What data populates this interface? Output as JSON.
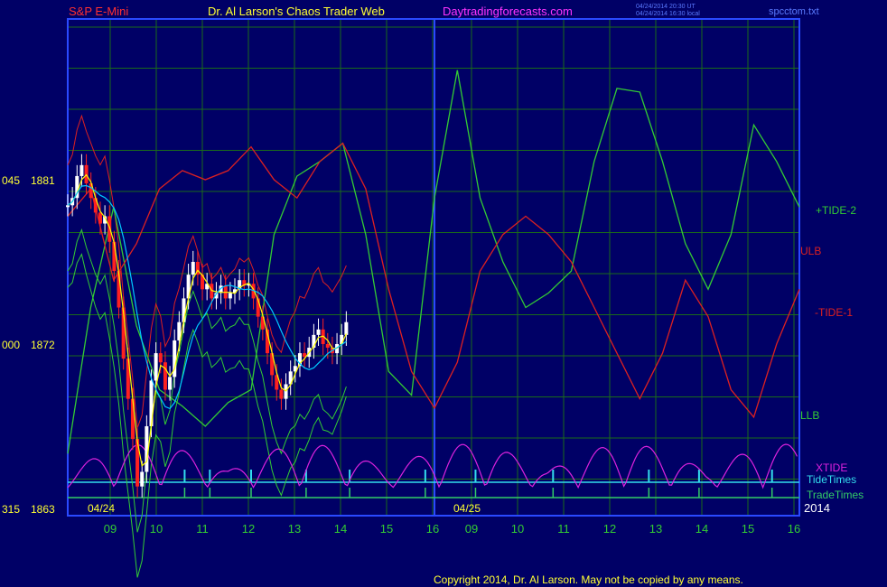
{
  "header": {
    "instrument": "S&P E-Mini",
    "site_title": "Dr. Al Larson's Chaos Trader Web",
    "site_url": "Daytradingforecasts.com",
    "stamp_line1": "04/24/2014 20:30 UT",
    "stamp_line2": "04/24/2014 16:30 local",
    "filename": "spcctom.txt"
  },
  "footer": {
    "copyright": "Copyright 2014, Dr. Al Larson. May not be copied by any means."
  },
  "colors": {
    "background": "#000066",
    "frame": "#2a4aff",
    "grid": "#1a6a1a",
    "price_up": "#ffffff",
    "price_down": "#ff2020",
    "ma_yellow": "#ffff00",
    "ma_cyan": "#00c8ff",
    "tide2": "#33cc33",
    "tide1": "#dd2020",
    "xtide": "#dd22dd",
    "tidetimes": "#33ddee",
    "tradetimes": "#33cc66"
  },
  "chart_data": {
    "type": "line",
    "title": "S&P E-Mini",
    "price_axis": {
      "ticks": [
        1881,
        1872,
        1863
      ],
      "alt_ticks": [
        "045",
        "000",
        "315"
      ],
      "ylim": [
        1863,
        1883
      ]
    },
    "x_hour_labels": [
      "09",
      "10",
      "11",
      "12",
      "13",
      "14",
      "15",
      "16",
      "09",
      "10",
      "11",
      "12",
      "13",
      "14",
      "15",
      "16"
    ],
    "date_labels": [
      "04/24",
      "04/25"
    ],
    "year_label": "2014",
    "xlim": [
      0,
      16
    ],
    "grid": true,
    "legend": {
      "placement": "right",
      "entries": [
        "+TIDE-2",
        "ULB",
        "-TIDE-1",
        "LLB",
        "XTIDE",
        "TideTimes",
        "TradeTimes"
      ]
    },
    "price": {
      "x": [
        0.0,
        0.1,
        0.2,
        0.3,
        0.4,
        0.5,
        0.6,
        0.7,
        0.8,
        0.9,
        1.0,
        1.1,
        1.2,
        1.3,
        1.4,
        1.5,
        1.6,
        1.7,
        1.8,
        1.9,
        2.0,
        2.1,
        2.2,
        2.3,
        2.4,
        2.5,
        2.6,
        2.7,
        2.8,
        2.9,
        3.0,
        3.1,
        3.2,
        3.3,
        3.4,
        3.5,
        3.6,
        3.7,
        3.8,
        3.9,
        4.0,
        4.1,
        4.2,
        4.3,
        4.4,
        4.5,
        4.6,
        4.7,
        4.8,
        4.9,
        5.0,
        5.1,
        5.2,
        5.3,
        5.4,
        5.5,
        5.6,
        5.7,
        5.8,
        5.9,
        6.0,
        6.1,
        6.2,
        6.3,
        6.4,
        6.5,
        6.6,
        6.7,
        6.8,
        6.9,
        7.0,
        7.1,
        7.2,
        7.3,
        7.4,
        7.5,
        7.6,
        7.7,
        7.8,
        7.9
      ],
      "y": [
        1879.6,
        1880.0,
        1881.2,
        1881.8,
        1880.8,
        1880.0,
        1879.2,
        1878.6,
        1879.0,
        1877.6,
        1876.0,
        1874.0,
        1871.2,
        1869.0,
        1866.8,
        1864.2,
        1865.0,
        1867.5,
        1870.0,
        1871.5,
        1871.0,
        1869.5,
        1870.2,
        1872.2,
        1873.2,
        1874.5,
        1875.8,
        1876.5,
        1875.8,
        1875.0,
        1875.3,
        1874.5,
        1874.8,
        1875.2,
        1874.5,
        1874.8,
        1875.0,
        1875.5,
        1875.2,
        1875.3,
        1874.5,
        1873.5,
        1872.8,
        1871.5,
        1870.3,
        1869.5,
        1869.0,
        1869.8,
        1870.5,
        1870.8,
        1871.5,
        1871.3,
        1871.8,
        1872.5,
        1872.8,
        1872.0,
        1871.8,
        1871.5,
        1872.0,
        1872.5,
        1873.2
      ],
      "note": "intraday close values read from the 04/24 session"
    },
    "series": [
      {
        "name": "+TIDE-2",
        "x": [
          0,
          0.5,
          1,
          1.5,
          2,
          2.5,
          3,
          3.5,
          4,
          4.5,
          5,
          5.5,
          6,
          6.5,
          7,
          7.5,
          8,
          8.5,
          9,
          9.5,
          10,
          10.5,
          11,
          11.5,
          12,
          12.5,
          13,
          13.5,
          14,
          14.5,
          15,
          15.5,
          16
        ],
        "y": [
          1866.0,
          1874.0,
          1879.5,
          1873.0,
          1869.5,
          1868.6,
          1867.5,
          1868.8,
          1869.5,
          1878.0,
          1881.2,
          1882.0,
          1883.0,
          1878.0,
          1870.5,
          1869.2,
          1880.0,
          1887.0,
          1880.0,
          1876.5,
          1874.0,
          1874.8,
          1876.0,
          1882.0,
          1886.0,
          1885.8,
          1882.0,
          1877.5,
          1875.0,
          1878.0,
          1884.0,
          1882.0,
          1879.5
        ]
      },
      {
        "name": "-TIDE-1",
        "x": [
          0,
          0.5,
          1,
          1.5,
          2,
          2.5,
          3,
          3.5,
          4,
          4.5,
          5,
          5.5,
          6,
          6.5,
          7,
          7.5,
          8,
          8.5,
          9,
          9.5,
          10,
          10.5,
          11,
          11.5,
          12,
          12.5,
          13,
          13.5,
          14,
          14.5,
          15,
          15.5,
          16
        ],
        "y": [
          1879.0,
          1880.5,
          1875.5,
          1877.5,
          1880.5,
          1881.5,
          1881.0,
          1881.5,
          1882.8,
          1881.0,
          1880.0,
          1882.0,
          1883.0,
          1880.5,
          1875.0,
          1870.5,
          1868.5,
          1871.0,
          1876.0,
          1878.0,
          1879.0,
          1878.0,
          1876.5,
          1874.0,
          1871.5,
          1869.0,
          1871.5,
          1875.5,
          1873.5,
          1869.5,
          1868.0,
          1872.0,
          1875.0
        ]
      }
    ]
  }
}
